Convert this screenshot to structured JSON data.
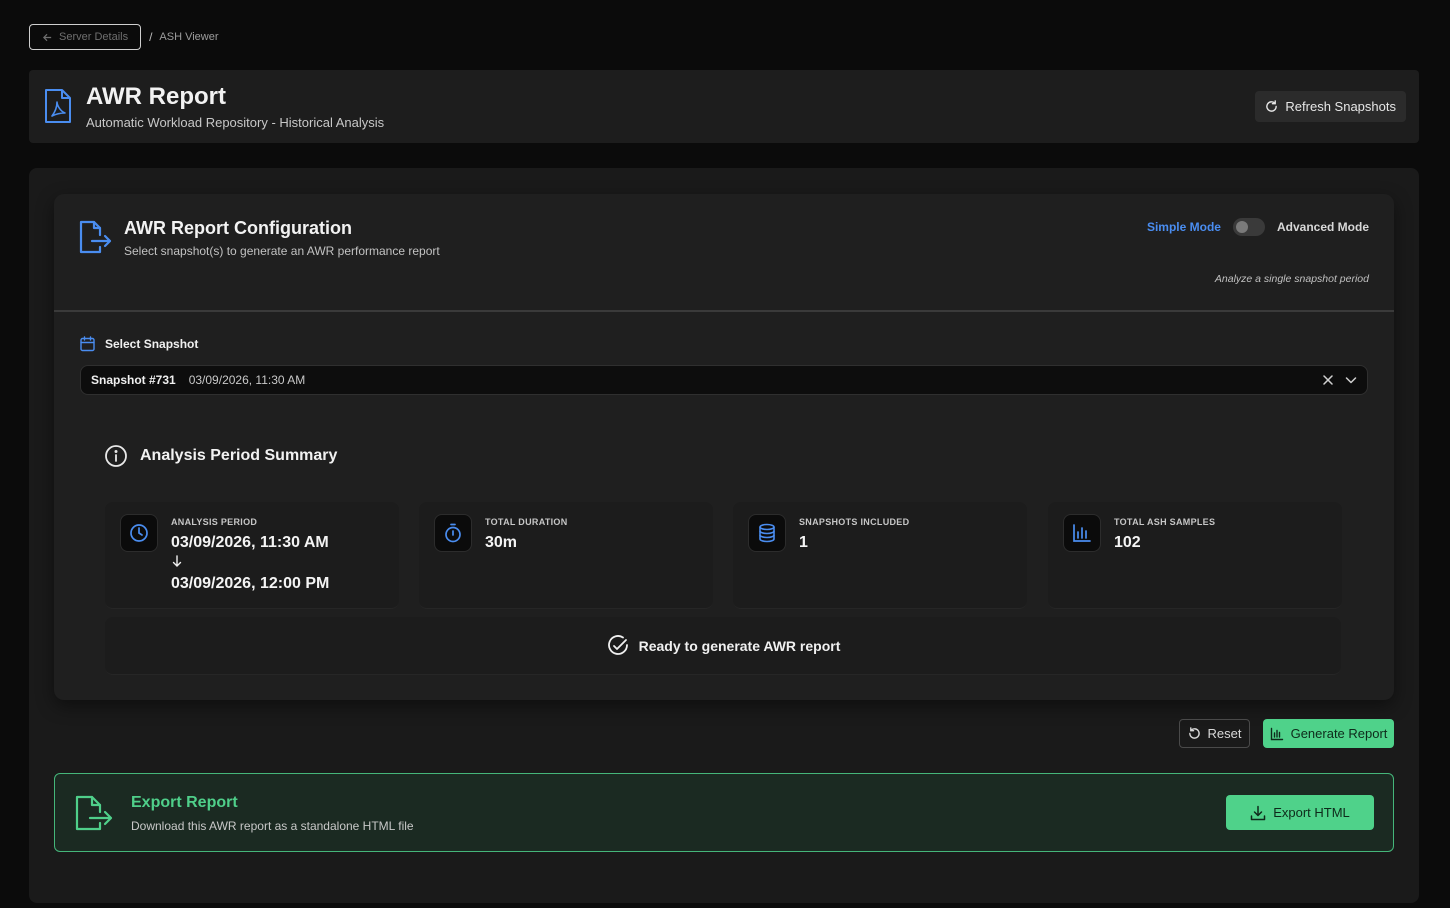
{
  "breadcrumb": {
    "back_label": "Server Details",
    "separator": "/",
    "current": "ASH Viewer"
  },
  "header": {
    "icon": "file-pdf-icon",
    "title": "AWR Report",
    "subtitle": "Automatic Workload Repository - Historical Analysis",
    "refresh_label": "Refresh Snapshots"
  },
  "config": {
    "icon": "file-export-icon",
    "title": "AWR Report Configuration",
    "subtitle": "Select snapshot(s) to generate an AWR performance report",
    "mode": {
      "simple_label": "Simple Mode",
      "advanced_label": "Advanced Mode",
      "current": "simple",
      "hint": "Analyze a single snapshot period"
    },
    "select_label": "Select Snapshot",
    "selected_snapshot": {
      "id": "Snapshot #731",
      "date": "03/09/2026, 11:30 AM"
    }
  },
  "summary": {
    "title": "Analysis Period Summary",
    "stats": [
      {
        "icon": "clock-icon",
        "label": "ANALYSIS PERIOD",
        "value": "03/09/2026, 11:30 AM",
        "value2": "03/09/2026, 12:00 PM"
      },
      {
        "icon": "stopwatch-icon",
        "label": "TOTAL DURATION",
        "value": "30m"
      },
      {
        "icon": "database-icon",
        "label": "SNAPSHOTS INCLUDED",
        "value": "1"
      },
      {
        "icon": "bar-chart-icon",
        "label": "TOTAL ASH SAMPLES",
        "value": "102"
      }
    ],
    "ready_text": "Ready to generate AWR report"
  },
  "actions": {
    "reset_label": "Reset",
    "generate_label": "Generate Report"
  },
  "export": {
    "title": "Export Report",
    "subtitle": "Download this AWR report as a standalone HTML file",
    "button_label": "Export HTML"
  },
  "colors": {
    "accent_blue": "#4a8df0",
    "accent_green": "#4fd28a",
    "background": "#0b0b0b"
  }
}
